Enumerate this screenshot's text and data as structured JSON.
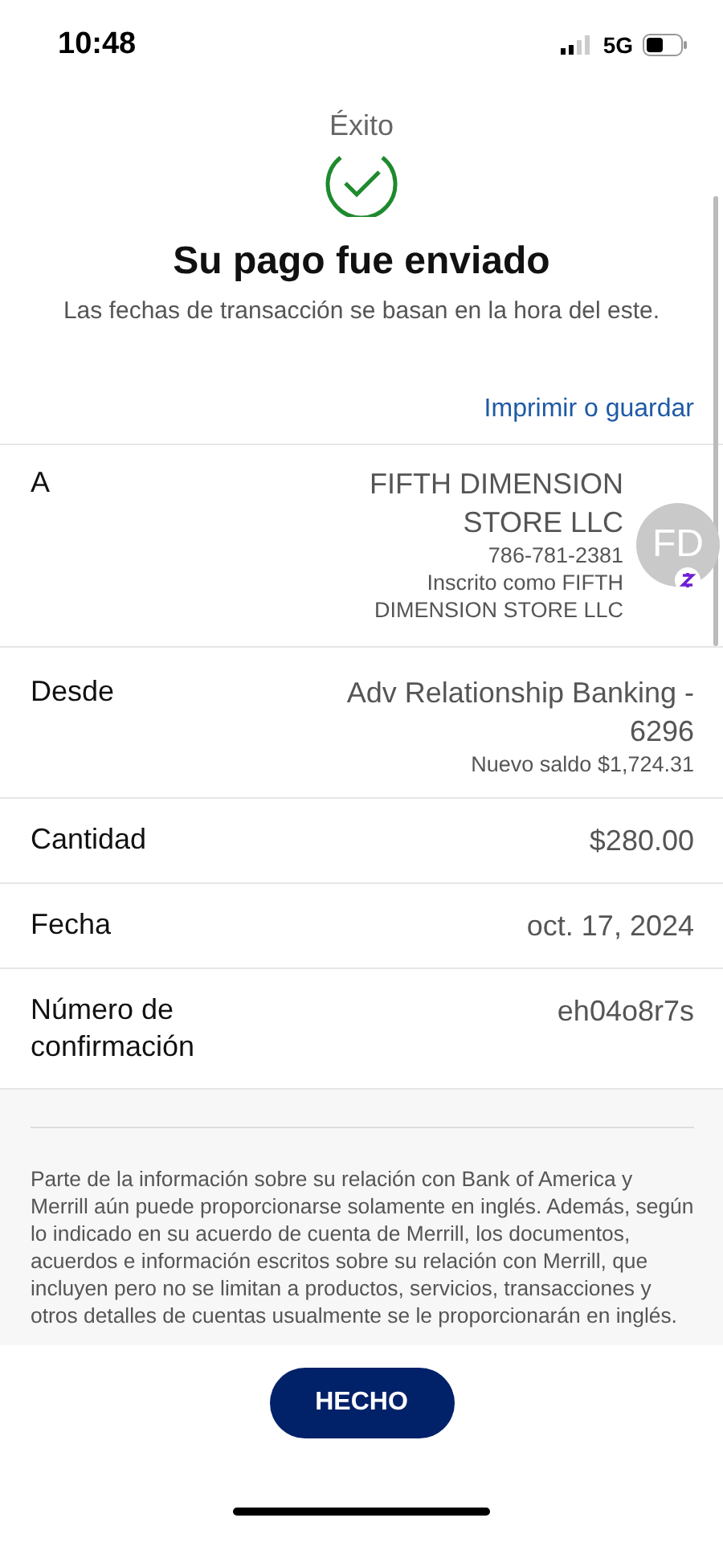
{
  "status_bar": {
    "time": "10:48",
    "network": "5G"
  },
  "header": {
    "title": "Éxito",
    "heading": "Su pago fue enviado",
    "subtitle": "Las fechas de transacción se basan en la hora del este."
  },
  "print_link": "Imprimir o guardar",
  "details": [
    {
      "kind": "payee",
      "label": "A",
      "value": "FIFTH DIMENSION STORE LLC",
      "phone": "786-781-2381",
      "note": "Inscrito como FIFTH DIMENSION STORE LLC",
      "avatar": "FD"
    },
    {
      "kind": "account",
      "label": "Desde",
      "value": "Adv Relationship Banking - 6296",
      "note": "Nuevo saldo $1,724.31"
    },
    {
      "kind": "plain",
      "label": "Cantidad",
      "value": "$280.00"
    },
    {
      "kind": "plain",
      "label": "Fecha",
      "value": "oct. 17, 2024"
    },
    {
      "kind": "plain",
      "label": "Número de confirmación",
      "value": "eh04o8r7s"
    }
  ],
  "disclaimer": "Parte de la información sobre su relación con Bank of America y Merrill aún puede proporcionarse solamente en inglés. Además, según lo indicado en su acuerdo de cuenta de Merrill, los documentos, acuerdos e información escritos sobre su relación con Merrill, que incluyen pero no se limitan a productos, servicios, transacciones y otros detalles de cuentas usualmente se le proporcionarán en inglés.",
  "done_button": "HECHO"
}
